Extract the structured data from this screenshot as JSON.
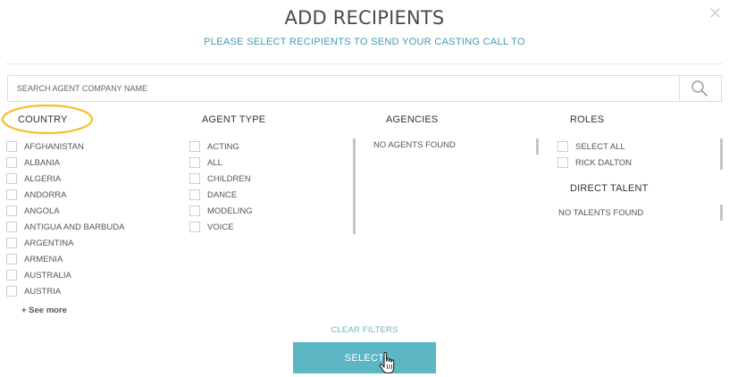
{
  "header": {
    "title": "ADD RECIPIENTS",
    "subtitle": "PLEASE SELECT RECIPIENTS TO SEND YOUR CASTING CALL TO",
    "close_label": "✕"
  },
  "search": {
    "placeholder": "SEARCH AGENT COMPANY NAME",
    "value": ""
  },
  "country": {
    "heading": "COUNTRY",
    "items": [
      "AFGHANISTAN",
      "ALBANIA",
      "ALGERIA",
      "ANDORRA",
      "ANGOLA",
      "ANTIGUA AND BARBUDA",
      "ARGENTINA",
      "ARMENIA",
      "AUSTRALIA",
      "AUSTRIA"
    ],
    "see_more": "+ See more"
  },
  "agent_type": {
    "heading": "AGENT TYPE",
    "items": [
      "ACTING",
      "ALL",
      "CHILDREN",
      "DANCE",
      "MODELING",
      "VOICE"
    ]
  },
  "agencies": {
    "heading": "AGENCIES",
    "empty": "NO AGENTS FOUND"
  },
  "roles": {
    "heading": "ROLES",
    "items": [
      "SELECT ALL",
      "RICK DALTON"
    ]
  },
  "direct_talent": {
    "heading": "DIRECT TALENT",
    "empty": "NO TALENTS FOUND"
  },
  "footer": {
    "clear_filters": "CLEAR FILTERS",
    "select_label": "SELECT"
  },
  "colors": {
    "accent": "#5db6c3",
    "subtitle": "#3f9bb0",
    "highlight": "#f2c12e"
  }
}
